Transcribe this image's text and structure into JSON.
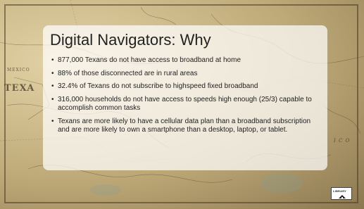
{
  "slide": {
    "title": "Digital Navigators: Why",
    "bullets": [
      "877,000 Texans do not have access to broadband at home",
      "88% of those disconnected are in rural areas",
      "32.4% of Texans do not subscribe to highspeed fixed broadband",
      "316,000 households do not have access to speeds high enough (25/3) capable to accomplish common tasks",
      "Texans are more likely to have a cellular data plan than a broadband subscription and are more likely to own a smartphone than a desktop, laptop, or tablet."
    ]
  },
  "background": {
    "map_labels": [
      "MEXICO",
      "TEXA",
      "I C O"
    ]
  },
  "logo": {
    "text": "LIBRARY"
  }
}
